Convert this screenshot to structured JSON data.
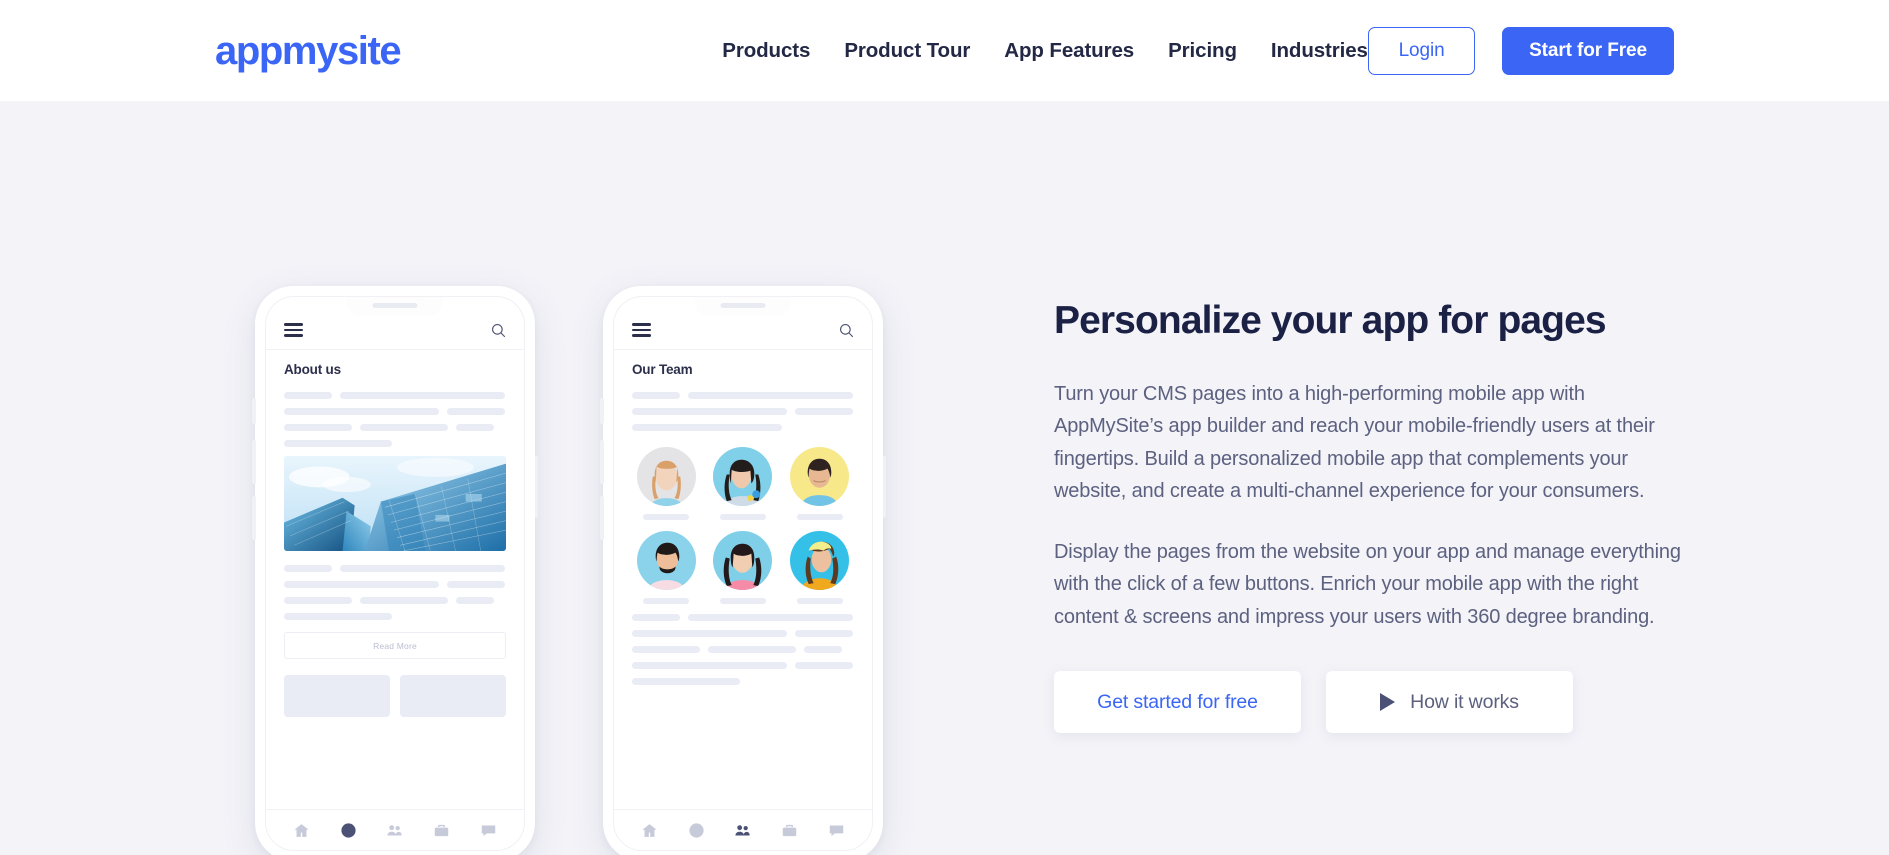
{
  "header": {
    "logo": {
      "part1": "app",
      "part2": "my",
      "part3": "site",
      "color": "#3b66f5"
    },
    "nav": [
      {
        "label": "Products"
      },
      {
        "label": "Product Tour"
      },
      {
        "label": "App Features"
      },
      {
        "label": "Pricing"
      },
      {
        "label": "Industries"
      }
    ],
    "login_label": "Login",
    "start_label": "Start for Free"
  },
  "hero": {
    "title": "Personalize your app for pages",
    "paragraph1": "Turn your CMS pages into a high-performing mobile app with AppMySite’s app builder and reach your mobile-friendly users at their fingertips. Build a personalized mobile app that complements your website, and create a multi-channel experience for your consumers.",
    "paragraph2": "Display the pages from the website on your app and manage everything with the click of a few buttons. Enrich your mobile app with the right content & screens and impress your users with 360 degree branding.",
    "cta_primary": "Get started for free",
    "cta_secondary": "How it works"
  },
  "phone1": {
    "screen_title": "About us",
    "read_more_label": "Read More",
    "tabs": [
      {
        "icon": "home-icon",
        "active": false
      },
      {
        "icon": "info-icon",
        "active": true
      },
      {
        "icon": "people-icon",
        "active": false
      },
      {
        "icon": "briefcase-icon",
        "active": false
      },
      {
        "icon": "chat-icon",
        "active": false
      }
    ]
  },
  "phone2": {
    "screen_title": "Our Team",
    "avatars": [
      {
        "bg": "#e4e4e6",
        "hair": "#d9a06a",
        "skin": "#f2d3bb",
        "shirt": "#8fd2ea"
      },
      {
        "bg": "#7fd0e8",
        "hair": "#221c1b",
        "skin": "#f0c9ac",
        "shirt": "#cfdce8"
      },
      {
        "bg": "#f7e98a",
        "hair": "#2e2320",
        "skin": "#e8b893",
        "shirt": "#72c4e6"
      },
      {
        "bg": "#8ad3ea",
        "hair": "#1f1a18",
        "skin": "#edbe99",
        "shirt": "#f7dde3"
      },
      {
        "bg": "#7fcfe9",
        "hair": "#23191a",
        "skin": "#f1cdb2",
        "shirt": "#f58ba6"
      },
      {
        "bg": "#35c0e8",
        "hair": "#5c3a22",
        "skin": "#edc19f",
        "shirt": "#f0a81e"
      }
    ],
    "tabs": [
      {
        "icon": "home-icon",
        "active": false
      },
      {
        "icon": "info-icon",
        "active": false
      },
      {
        "icon": "people-icon",
        "active": true
      },
      {
        "icon": "briefcase-icon",
        "active": false
      },
      {
        "icon": "chat-icon",
        "active": false
      }
    ]
  },
  "theme": {
    "brand": "#3b66f5",
    "page_bg": "#f3f3f8",
    "header_bg": "#ffffff",
    "heading_color": "#1b2045",
    "body_text_color": "#5c6180",
    "skeleton_color": "#e9ebf5"
  }
}
